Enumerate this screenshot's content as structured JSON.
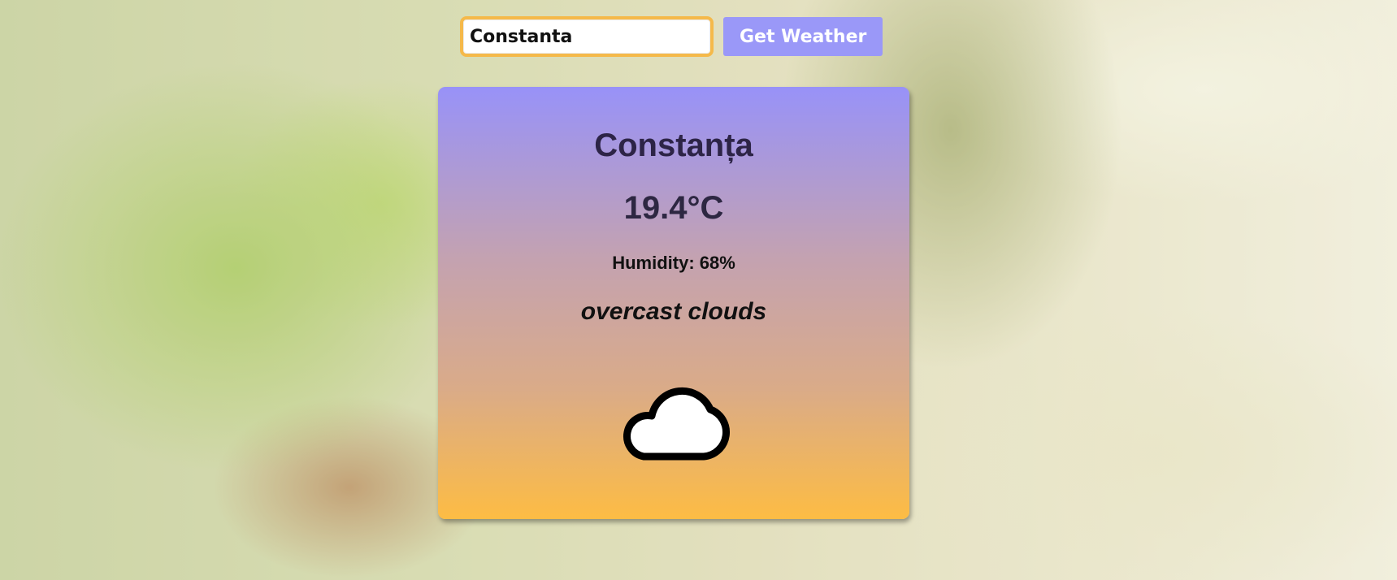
{
  "search": {
    "value": "Constanta",
    "button_label": "Get Weather"
  },
  "weather": {
    "city": "Constanța",
    "temperature": "19.4°C",
    "humidity": "Humidity: 68%",
    "description": "overcast clouds",
    "icon": "cloud-icon"
  },
  "colors": {
    "button": "#9a98f8",
    "input_border": "#f5b94a",
    "card_top": "#9892f8",
    "card_bottom": "#fdbc44"
  }
}
